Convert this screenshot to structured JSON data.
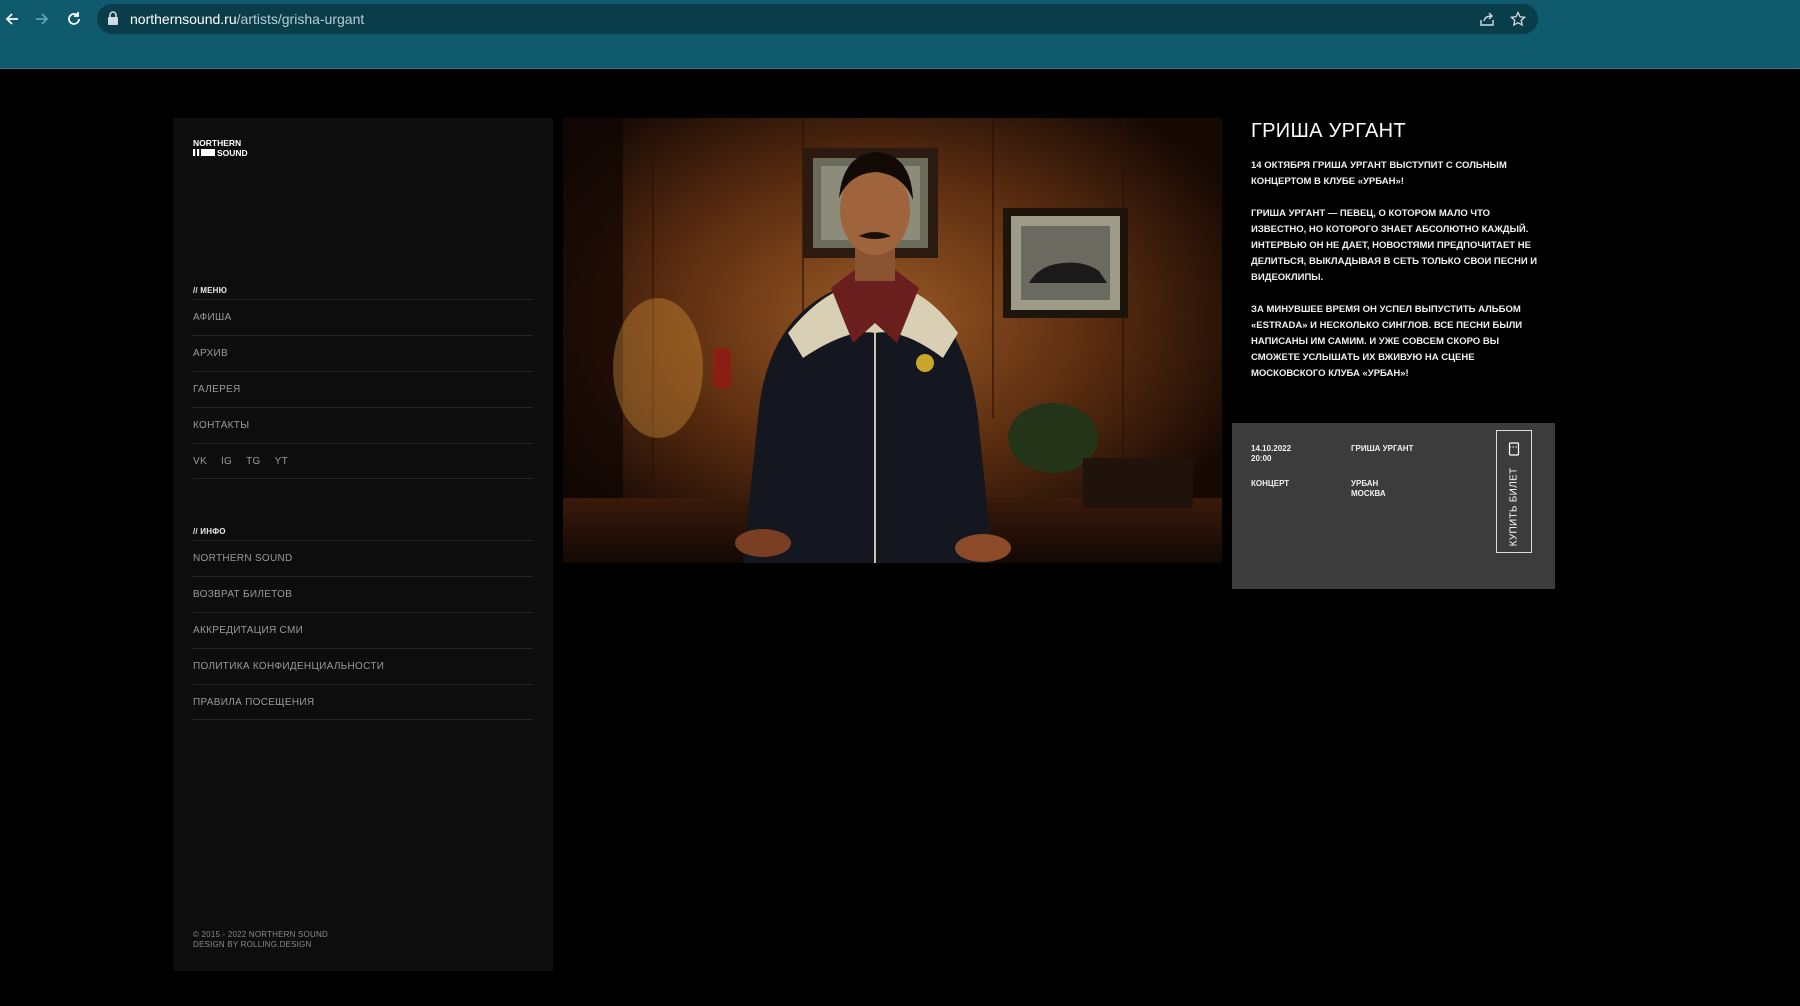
{
  "browser": {
    "url_host": "northernsound.ru",
    "url_path": "/artists/grisha-urgant",
    "icons": [
      "back-arrow-icon",
      "forward-arrow-icon",
      "reload-icon",
      "lock-icon",
      "share-icon",
      "bookmark-star-icon"
    ]
  },
  "sidebar": {
    "logo": {
      "line1": "NORTHERN",
      "line2": "SOUND"
    },
    "menu_label": "// МЕНЮ",
    "menu_items": [
      {
        "label": "АФИША"
      },
      {
        "label": "АРХИВ"
      },
      {
        "label": "ГАЛЕРЕЯ"
      },
      {
        "label": "КОНТАКТЫ"
      }
    ],
    "social": [
      {
        "label": "VK"
      },
      {
        "label": "IG"
      },
      {
        "label": "TG"
      },
      {
        "label": "YT"
      }
    ],
    "info_label": "// ИНФО",
    "info_items": [
      {
        "label": "NORTHERN SOUND"
      },
      {
        "label": "ВОЗВРАТ БИЛЕТОВ"
      },
      {
        "label": "АККРЕДИТАЦИЯ СМИ"
      },
      {
        "label": "ПОЛИТИКА КОНФИДЕНЦИАЛЬНОСТИ"
      },
      {
        "label": "ПРАВИЛА ПОСЕЩЕНИЯ"
      }
    ],
    "footer": {
      "copyright": "© 2015 - 2022 NORTHERN SOUND",
      "design": "DESIGN BY ROLLING.DESIGN"
    }
  },
  "article": {
    "title": "ГРИША УРГАНТ",
    "paragraphs": [
      "14 ОКТЯБРЯ ГРИША УРГАНТ ВЫСТУПИТ С СОЛЬНЫМ КОНЦЕРТОМ В КЛУБЕ «УРБАН»!",
      "ГРИША УРГАНТ — ПЕВЕЦ, О КОТОРОМ МАЛО ЧТО ИЗВЕСТНО, НО КОТОРОГО ЗНАЕТ АБСОЛЮТНО КАЖДЫЙ. ИНТЕРВЬЮ ОН НЕ ДАЕТ, НОВОСТЯМИ ПРЕДПОЧИТАЕТ НЕ ДЕЛИТЬСЯ, ВЫКЛАДЫВАЯ В СЕТЬ ТОЛЬКО СВОИ ПЕСНИ И ВИДЕОКЛИПЫ.",
      "ЗА МИНУВШЕЕ ВРЕМЯ ОН УСПЕЛ ВЫПУСТИТЬ АЛЬБОМ «ESTRADA» И НЕСКОЛЬКО СИНГЛОВ. ВСЕ ПЕСНИ БЫЛИ НАПИСАНЫ ИМ САМИМ. И УЖЕ СОВСЕМ СКОРО ВЫ СМОЖЕТЕ УСЛЫШАТЬ ИХ ВЖИВУЮ НА СЦЕНЕ МОСКОВСКОГО КЛУБА «УРБАН»!"
    ]
  },
  "event": {
    "date": "14.10.2022",
    "time": "20:00",
    "artist": "ГРИША УРГАНТ",
    "type": "КОНЦЕРТ",
    "venue": "УРБАН",
    "city": "МОСКВА",
    "buy_label": "КУПИТЬ БИЛЕТ"
  }
}
